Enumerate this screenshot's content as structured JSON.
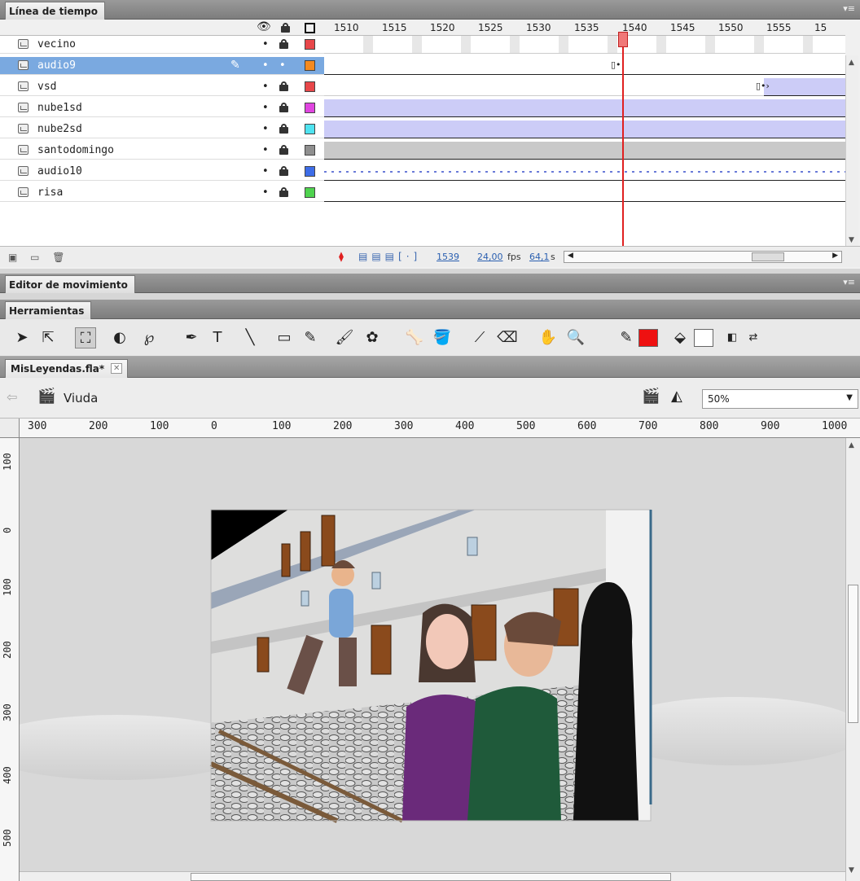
{
  "timeline": {
    "title": "Línea de tiempo",
    "frame_labels": [
      "1510",
      "1515",
      "1520",
      "1525",
      "1530",
      "1535",
      "1540",
      "1545",
      "1550",
      "1555",
      "15"
    ],
    "layers": [
      {
        "name": "vecino",
        "color": "#e8474a",
        "selected": false
      },
      {
        "name": "audio9",
        "color": "#f58a1f",
        "selected": true
      },
      {
        "name": "vsd",
        "color": "#e8474a",
        "selected": false
      },
      {
        "name": "nube1sd",
        "color": "#e045e0",
        "selected": false
      },
      {
        "name": "nube2sd",
        "color": "#4fe3f0",
        "selected": false
      },
      {
        "name": "santodomingo",
        "color": "#8f8f8f",
        "selected": false
      },
      {
        "name": "audio10",
        "color": "#3d6de8",
        "selected": false
      },
      {
        "name": "risa",
        "color": "#4fd34f",
        "selected": false
      }
    ],
    "current_frame": "1539",
    "fps": "24,00",
    "fps_unit": "fps",
    "time": "64,1",
    "time_unit": "s"
  },
  "motion_editor": {
    "title": "Editor de movimiento"
  },
  "tools": {
    "title": "Herramientas",
    "stroke_color": "#ee1111",
    "fill_color": "#ffffff"
  },
  "document": {
    "tab": "MisLeyendas.fla*",
    "scene": "Viuda",
    "zoom": "50%"
  },
  "hruler_labels": [
    "300",
    "200",
    "100",
    "0",
    "100",
    "200",
    "300",
    "400",
    "500",
    "600",
    "700",
    "800",
    "900",
    "1000"
  ],
  "vruler_labels": [
    "100",
    "0",
    "100",
    "200",
    "300",
    "400",
    "500"
  ]
}
